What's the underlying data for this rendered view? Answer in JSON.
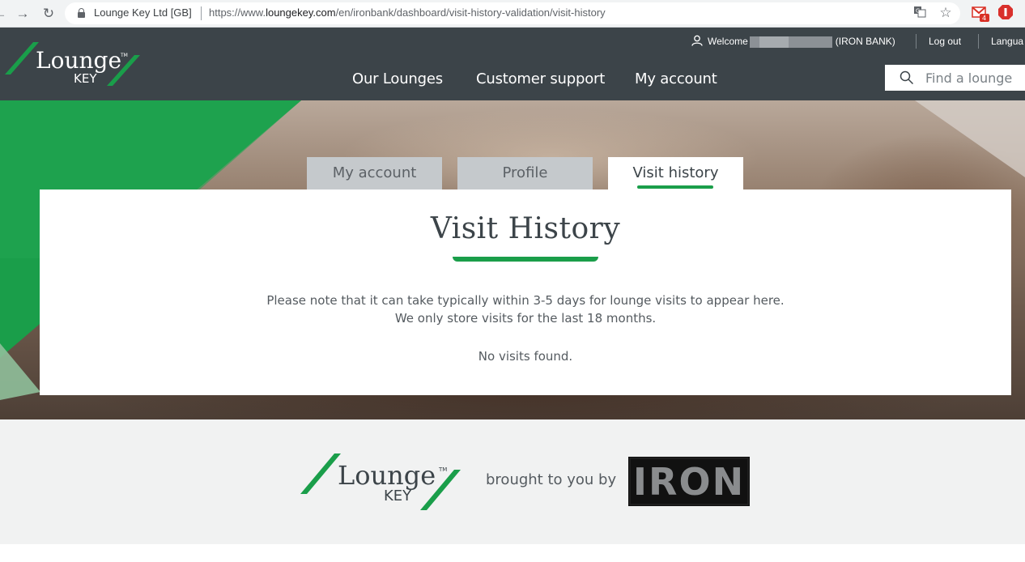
{
  "browser": {
    "site_name": "Lounge Key Ltd [GB]",
    "url_prefix": "https://www.",
    "url_host": "loungekey.com",
    "url_path": "/en/ironbank/dashboard/visit-history-validation/visit-history",
    "gmail_badge": "4"
  },
  "header": {
    "logo_text": "Lounge",
    "logo_sub": "KEY",
    "logo_tm": "TM",
    "welcome_prefix": "Welcome",
    "welcome_bank": "(IRON BANK)",
    "logout": "Log out",
    "language": "Langua",
    "nav": [
      "Our Lounges",
      "Customer support",
      "My account"
    ],
    "search_placeholder": "Find a lounge"
  },
  "tabs": [
    {
      "label": "My account",
      "active": false
    },
    {
      "label": "Profile",
      "active": false
    },
    {
      "label": "Visit history",
      "active": true
    }
  ],
  "card": {
    "title": "Visit History",
    "note_line1": "Please note that it can take typically within 3-5 days for lounge visits to appear here.",
    "note_line2": "We only store visits for the last 18 months.",
    "empty_message": "No visits found."
  },
  "footer": {
    "brought_by": "brought to you by",
    "partner_logo_text": "IRON"
  },
  "colors": {
    "header_bg": "#3c4449",
    "accent_green": "#1a9e4a",
    "tab_inactive": "#c5c9cc",
    "footer_bg": "#f1f2f2"
  }
}
